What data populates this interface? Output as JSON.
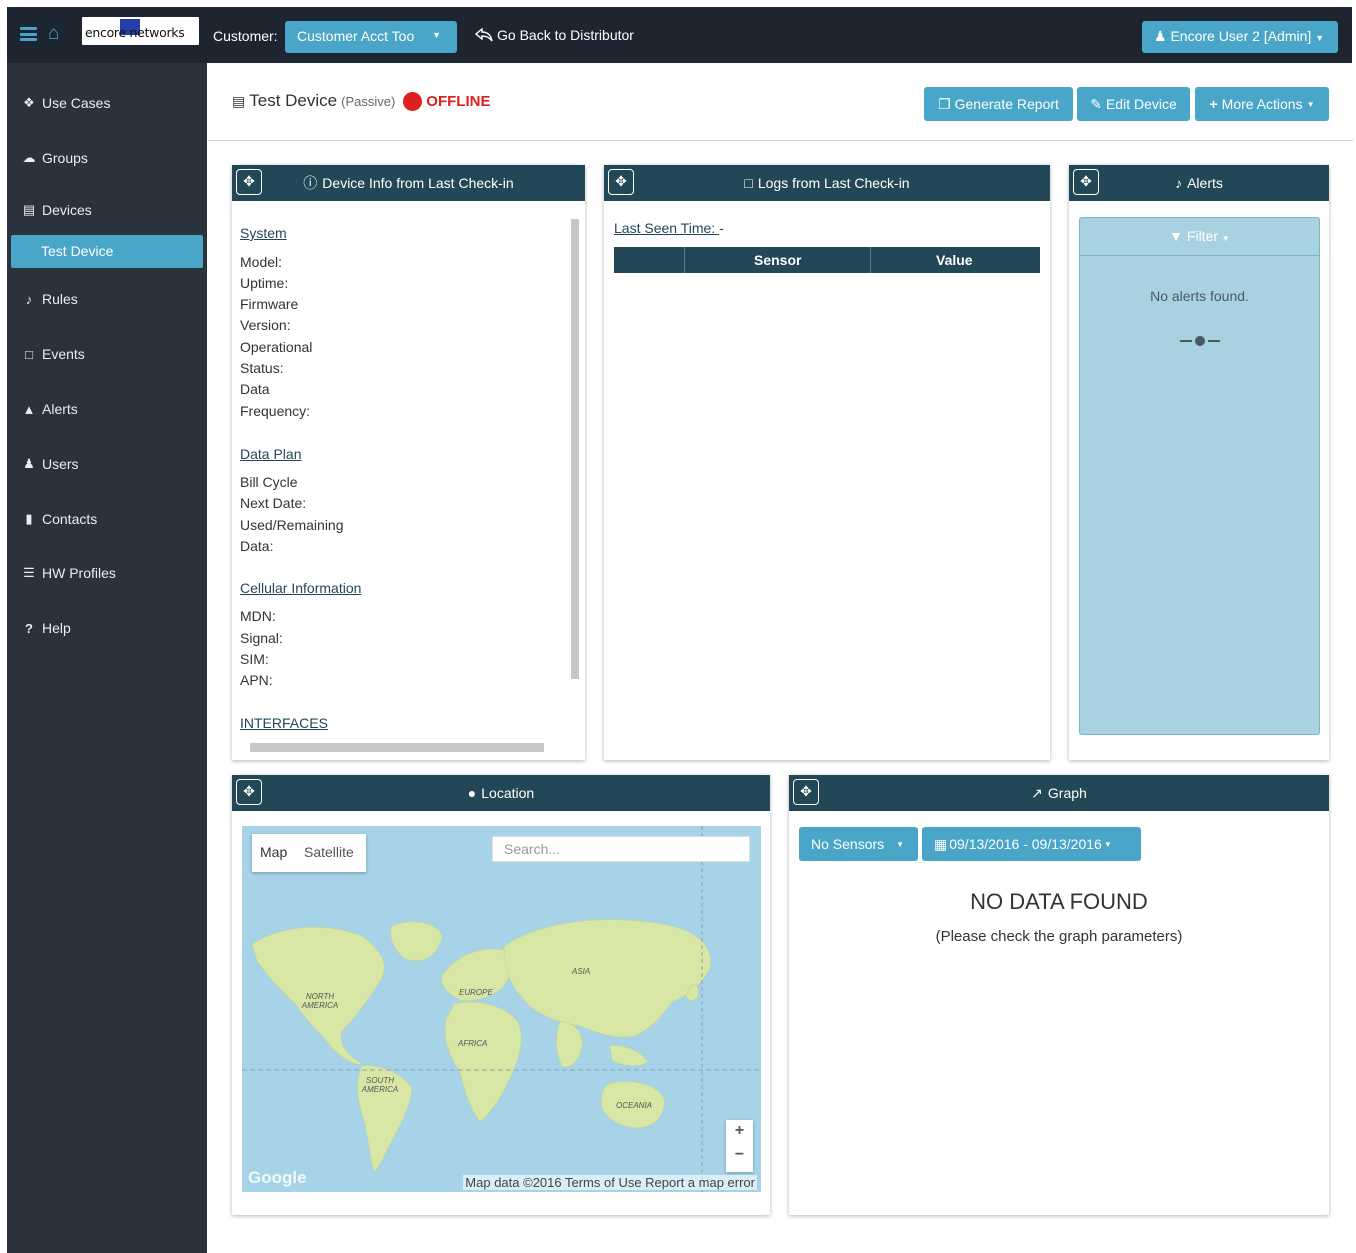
{
  "topbar": {
    "logo_text": "encore networks",
    "customer_label": "Customer:",
    "customer_value": "Customer Acct Too",
    "go_back": "Go Back to Distributor",
    "user": "Encore User 2 [Admin]"
  },
  "sidebar": {
    "items": [
      {
        "label": "Use Cases",
        "icon": "cubes-icon"
      },
      {
        "label": "Groups",
        "icon": "cloud-icon"
      },
      {
        "label": "Devices",
        "icon": "hdd-icon"
      },
      {
        "label": "Rules",
        "icon": "bell-icon"
      },
      {
        "label": "Events",
        "icon": "file-icon"
      },
      {
        "label": "Alerts",
        "icon": "warning-icon"
      },
      {
        "label": "Users",
        "icon": "users-icon"
      },
      {
        "label": "Contacts",
        "icon": "book-icon"
      },
      {
        "label": "HW Profiles",
        "icon": "server-icon"
      },
      {
        "label": "Help",
        "icon": "question-icon"
      }
    ],
    "sub_item": "Test Device"
  },
  "header": {
    "title": "Test Device",
    "mode": "(Passive)",
    "status": "OFFLINE",
    "status_color": "#dd1f1f",
    "buttons": {
      "report": "Generate Report",
      "edit": "Edit Device",
      "more": "More Actions"
    }
  },
  "device_info": {
    "title": "Device Info from Last Check-in",
    "system": "System",
    "model": "Model:",
    "uptime": "Uptime:",
    "firmware": "Firmware",
    "version": "Version:",
    "operational": "Operational",
    "status": "Status:",
    "data": "Data",
    "frequency": "Frequency:",
    "data_plan": "Data Plan",
    "bill_cycle": "Bill Cycle",
    "next_date": "Next Date:",
    "used_remaining": "Used/Remaining",
    "data2": "Data:",
    "cellular": "Cellular Information",
    "mdn": "MDN:",
    "signal": "Signal:",
    "sim": "SIM:",
    "apn": "APN:",
    "interfaces": "INTERFACES"
  },
  "logs": {
    "title": "Logs from Last Check-in",
    "last_seen_label": "Last Seen Time:",
    "last_seen_value": "-",
    "col_sensor": "Sensor",
    "col_value": "Value"
  },
  "alerts": {
    "title": "Alerts",
    "filter": "Filter",
    "empty": "No alerts found."
  },
  "location": {
    "title": "Location",
    "map_tab": "Map",
    "satellite_tab": "Satellite",
    "search_placeholder": "Search...",
    "labels": {
      "north_america": "NORTH AMERICA",
      "south_america": "SOUTH AMERICA",
      "europe": "EUROPE",
      "africa": "AFRICA",
      "asia": "ASIA",
      "oceania": "OCEANIA"
    },
    "google": "Google",
    "footer": "Map data ©2016  Terms of Use  Report a map error"
  },
  "graph": {
    "title": "Graph",
    "sensors_btn": "No Sensors",
    "date_range": "09/13/2016 - 09/13/2016",
    "no_data": "NO DATA FOUND",
    "no_data_sub": "(Please check the graph parameters)"
  },
  "colors": {
    "accent": "#49a6c8",
    "panel_header": "#224857",
    "sidebar": "#2a323b",
    "topbar": "#1d2630"
  }
}
